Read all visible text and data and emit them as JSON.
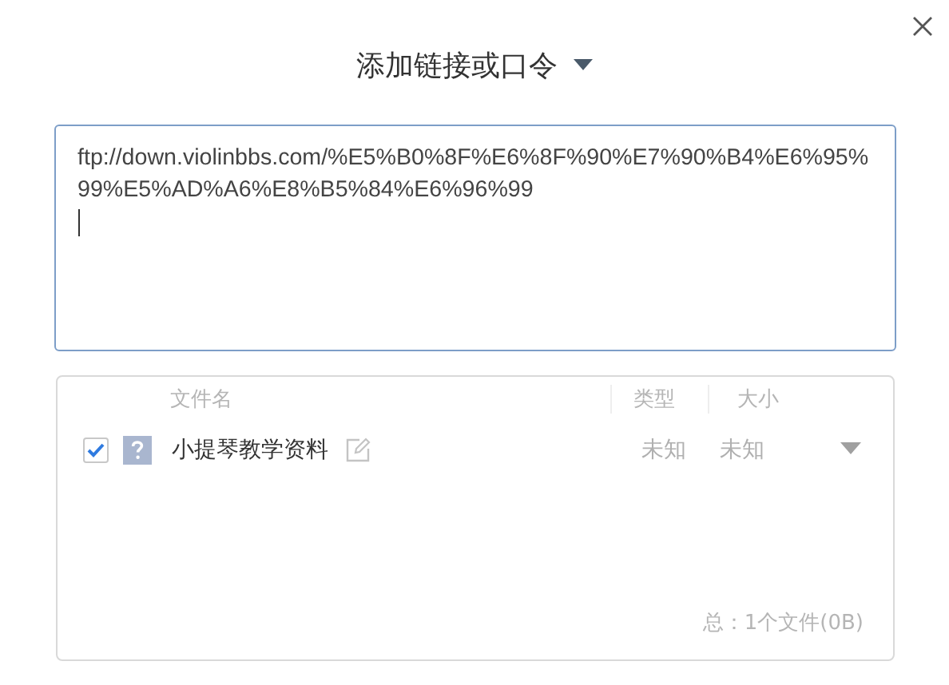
{
  "dialog": {
    "title": "添加链接或口令"
  },
  "link_field": {
    "value": "ftp://down.violinbbs.com/%E5%B0%8F%E6%8F%90%E7%90%B4%E6%95%99%E5%AD%A6%E8%B5%84%E6%96%99"
  },
  "file_list": {
    "columns": [
      "文件名",
      "类型",
      "大小"
    ],
    "files": [
      {
        "name": "小提琴教学资料",
        "type": "未知",
        "size": "未知",
        "checked": true
      }
    ],
    "summary": "总：1个文件(0B)"
  }
}
